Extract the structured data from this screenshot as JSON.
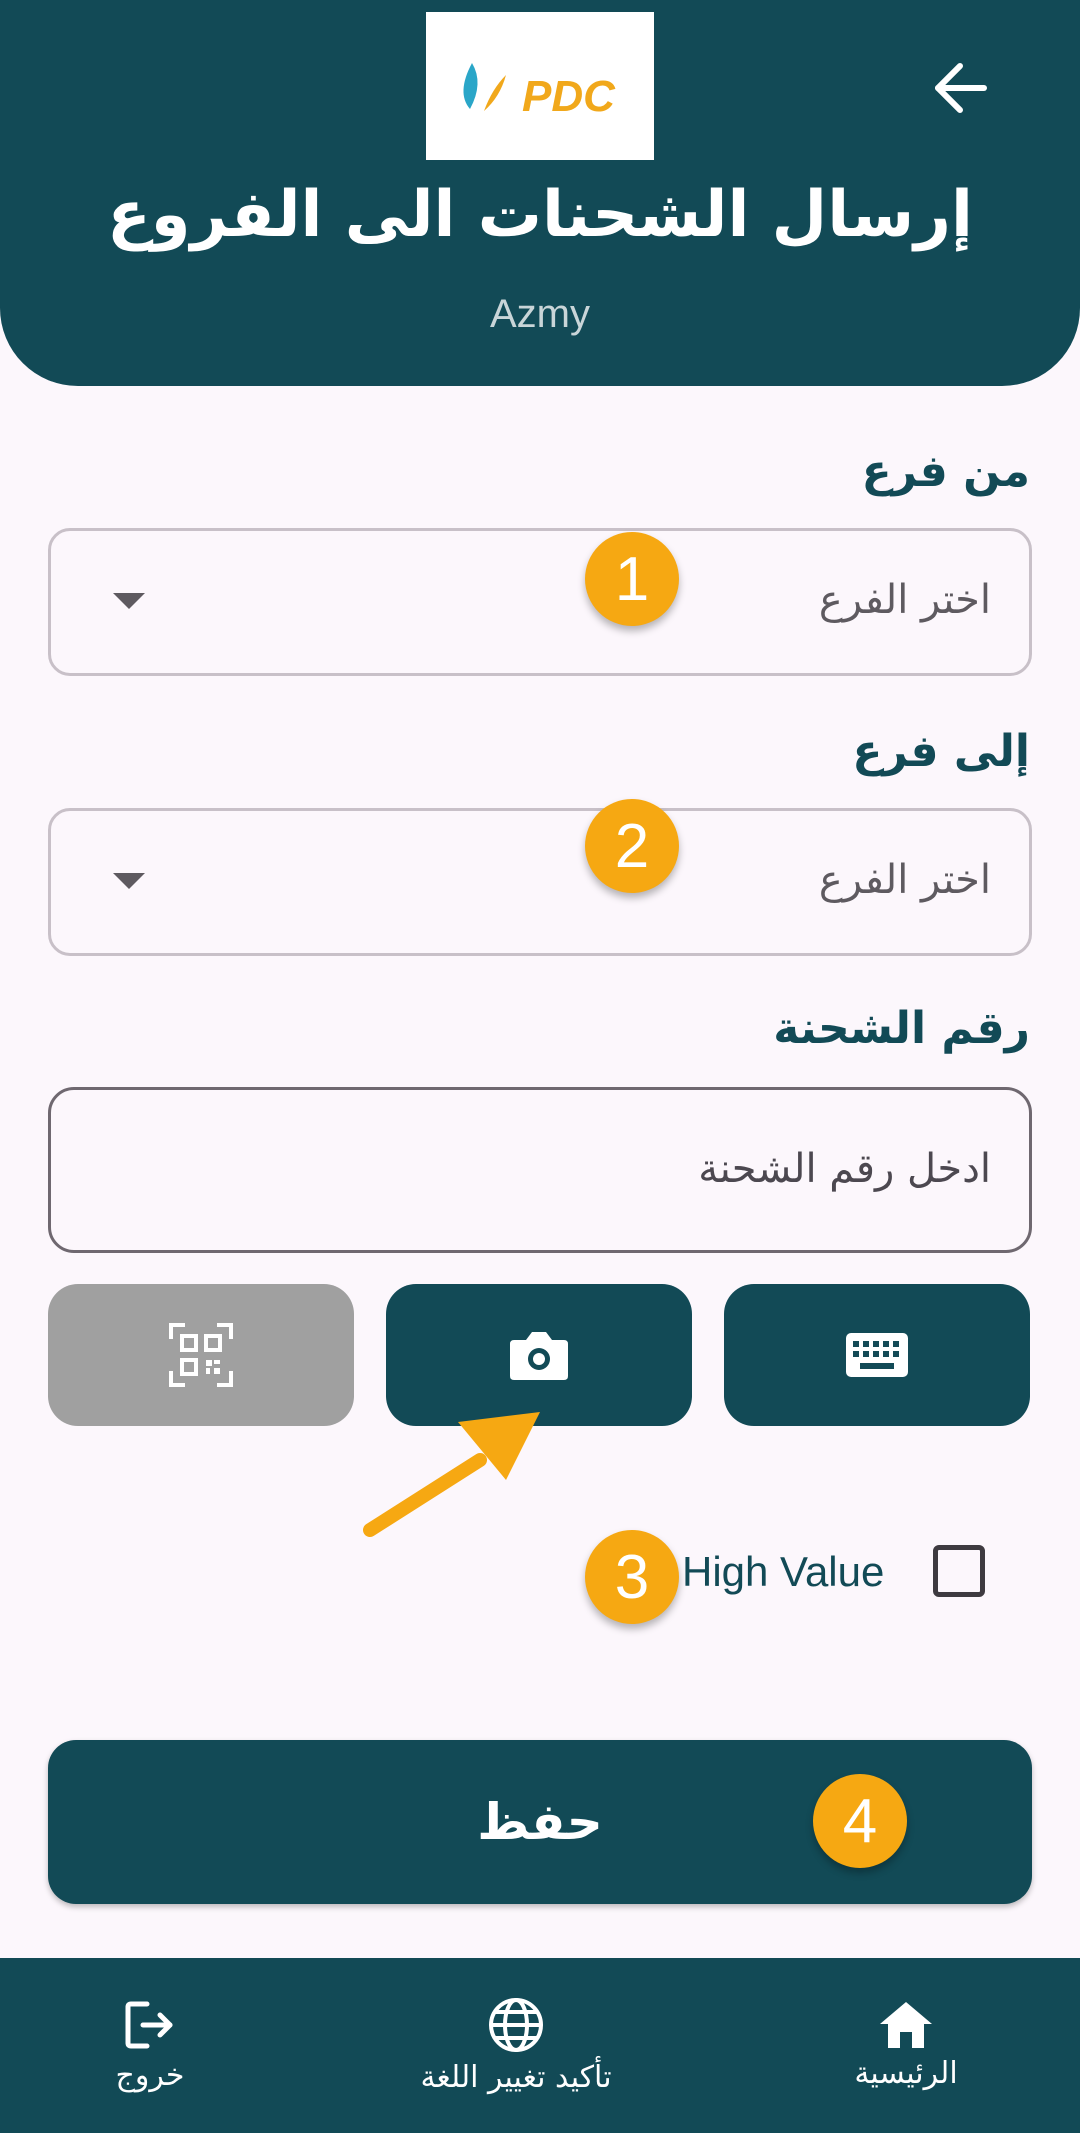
{
  "header": {
    "title": "إرسال الشحنات الى الفروع",
    "subtitle": "Azmy",
    "logo_text": "PDC"
  },
  "form": {
    "from_branch": {
      "label": "من فرع",
      "placeholder": "اختر الفرع"
    },
    "to_branch": {
      "label": "إلى فرع",
      "placeholder": "اختر الفرع"
    },
    "shipment_number": {
      "label": "رقم الشحنة",
      "placeholder": "ادخل رقم الشحنة"
    },
    "high_value": {
      "label": "High Value",
      "checked": false
    },
    "save_label": "حفظ"
  },
  "input_modes": [
    {
      "icon": "qr-code-scan-icon",
      "active": false
    },
    {
      "icon": "camera-icon",
      "active": true
    },
    {
      "icon": "keyboard-icon",
      "active": true
    }
  ],
  "annotations": [
    "1",
    "2",
    "3",
    "4"
  ],
  "bottom_nav": {
    "logout": "خروج",
    "language": "تأكيد تغيير اللغة",
    "home": "الرئيسية"
  },
  "colors": {
    "primary": "#124a56",
    "background": "#fcf7fc",
    "disabled": "#a0a0a0",
    "badge": "#f6a812"
  }
}
